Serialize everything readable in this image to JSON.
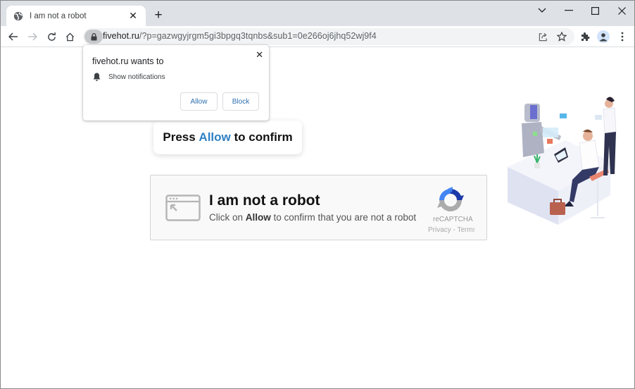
{
  "browser": {
    "tab": {
      "title": "I am not a robot",
      "favicon": "globe-icon"
    },
    "new_tab_label": "+",
    "window_controls": [
      "tab-search",
      "minimize",
      "maximize",
      "close"
    ],
    "address_bar": {
      "domain": "fivehot.ru",
      "path": "/?p=gazwgyjrgm5gi3bpgq3tqnbs&sub1=0e266oj6jhq52wj9f4"
    }
  },
  "permission_prompt": {
    "heading": "fivehot.ru wants to",
    "permission_label": "Show notifications",
    "allow_label": "Allow",
    "block_label": "Block",
    "close_glyph": "✕"
  },
  "page": {
    "press_prefix": "Press ",
    "press_accent": "Allow",
    "press_suffix": " to confirm",
    "accent_color": "#2f80c4",
    "captcha": {
      "title": "I am not a robot",
      "sub_prefix": "Click on ",
      "sub_bold": "Allow",
      "sub_suffix": " to confirm that you are not a robot",
      "brand": "reCAPTCHA",
      "links": "Privacy - Terms"
    }
  }
}
